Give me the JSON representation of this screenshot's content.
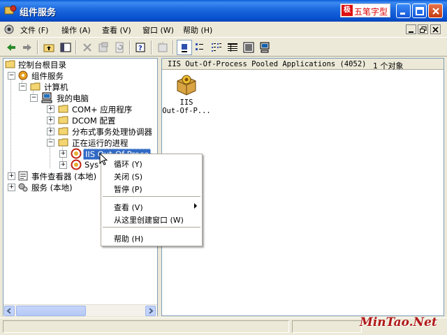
{
  "window": {
    "title": "组件服务"
  },
  "ime": {
    "icon_text": "极",
    "label": "五笔字型"
  },
  "menu": [
    {
      "label": "文件 (F)"
    },
    {
      "label": "操作 (A)"
    },
    {
      "label": "查看 (V)"
    },
    {
      "label": "窗口 (W)"
    },
    {
      "label": "帮助 (H)"
    }
  ],
  "tree": {
    "items": [
      {
        "label": "控制台根目录"
      },
      {
        "label": "组件服务"
      },
      {
        "label": "计算机"
      },
      {
        "label": "我的电脑"
      },
      {
        "label": "COM+ 应用程序"
      },
      {
        "label": "DCOM 配置"
      },
      {
        "label": "分布式事务处理协调器"
      },
      {
        "label": "正在运行的进程"
      },
      {
        "label": "IIS Out-Of-Proce"
      },
      {
        "label": "Sys"
      },
      {
        "label": "事件查看器 (本地)"
      },
      {
        "label": "服务 (本地)"
      }
    ]
  },
  "right_pane": {
    "header_title": "IIS Out-Of-Process Pooled Applications (4052)",
    "header_count": "1 个对象",
    "item_label_line1": "IIS",
    "item_label_line2": "Out-Of-P..."
  },
  "context_menu": {
    "items": [
      {
        "label": "循环 (Y)"
      },
      {
        "label": "关闭 (S)"
      },
      {
        "label": "暂停 (P)"
      },
      {
        "label": "查看 (V)"
      },
      {
        "label": "从这里创建窗口 (W)"
      },
      {
        "label": "帮助 (H)"
      }
    ]
  },
  "watermark": "MinTao.Net",
  "colors": {
    "titlebar": "#0A5BD6",
    "selection": "#316AC5",
    "close": "#C43A10"
  }
}
